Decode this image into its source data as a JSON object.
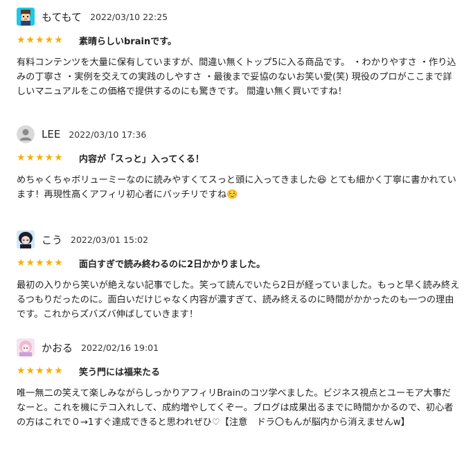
{
  "reviews": [
    {
      "user": "もてもて",
      "date": "2022/03/10 22:25",
      "stars": "★★★★★",
      "rating": 5,
      "title": "素晴らしいbrainです。",
      "body": "有料コンテンツを大量に保有していますが、間違い無くトップ5に入る商品です。 ・わかりやすさ ・作り込みの丁寧さ ・実例を交えての実践のしやすさ ・最後まで妥協のないお笑い愛(笑) 現役のプロがここまで詳しいマニュアルをこの価格で提供するのにも驚きです。 間違い無く買いですね！",
      "avatar_icon": "pixel-character-avatar-icon"
    },
    {
      "user": "LEE",
      "date": "2022/03/10 17:36",
      "stars": "★★★★★",
      "rating": 5,
      "title": "内容が「スっと」入ってくる！",
      "body": "めちゃくちゃボリューミーなのに読みやすくてスっと頭に入ってきました😆 とても細かく丁寧に書かれています！再現性高くアフィリ初心者にバッチリですね☺️",
      "avatar_icon": "default-user-icon"
    },
    {
      "user": "こう",
      "date": "2022/03/01 15:02",
      "stars": "★★★★★",
      "rating": 5,
      "title": "面白すぎで読み終わるのに2日かかりました。",
      "body": "最初の入りから笑いが絶えない記事でした。笑って読んでいたら2日が経っていました。もっと早く読み終えるつもりだったのに。面白いだけじゃなく内容が濃すぎて、読み終えるのに時間がかかったのも一つの理由です。これからズバズバ伸ばしていきます！",
      "avatar_icon": "anime-character-avatar-icon"
    },
    {
      "user": "かおる",
      "date": "2022/02/16 19:01",
      "stars": "★★★★★",
      "rating": 5,
      "title": "笑う門には福来たる",
      "body": "唯一無二の笑えて楽しみながらしっかりアフィリBrainのコツ学べました。ビジネス視点とユーモア大事だなーと。これを機にテコ入れして、成約増やしてくぞー。ブログは成果出るまでに時間かかるので、初心者の方はこれで０→1すぐ達成できると思われぜひ♡【注意　ドラ〇もんが脳内から消えませんw】",
      "avatar_icon": "pink-character-avatar-icon"
    }
  ],
  "colors": {
    "star": "#f5b000",
    "text": "#222222",
    "avatar1_bg": "#1ec8e6",
    "avatar2_bg": "#d9d9d9",
    "avatar3_bg": "#cfe8f5",
    "avatar4_bg": "#f4e4ef"
  }
}
